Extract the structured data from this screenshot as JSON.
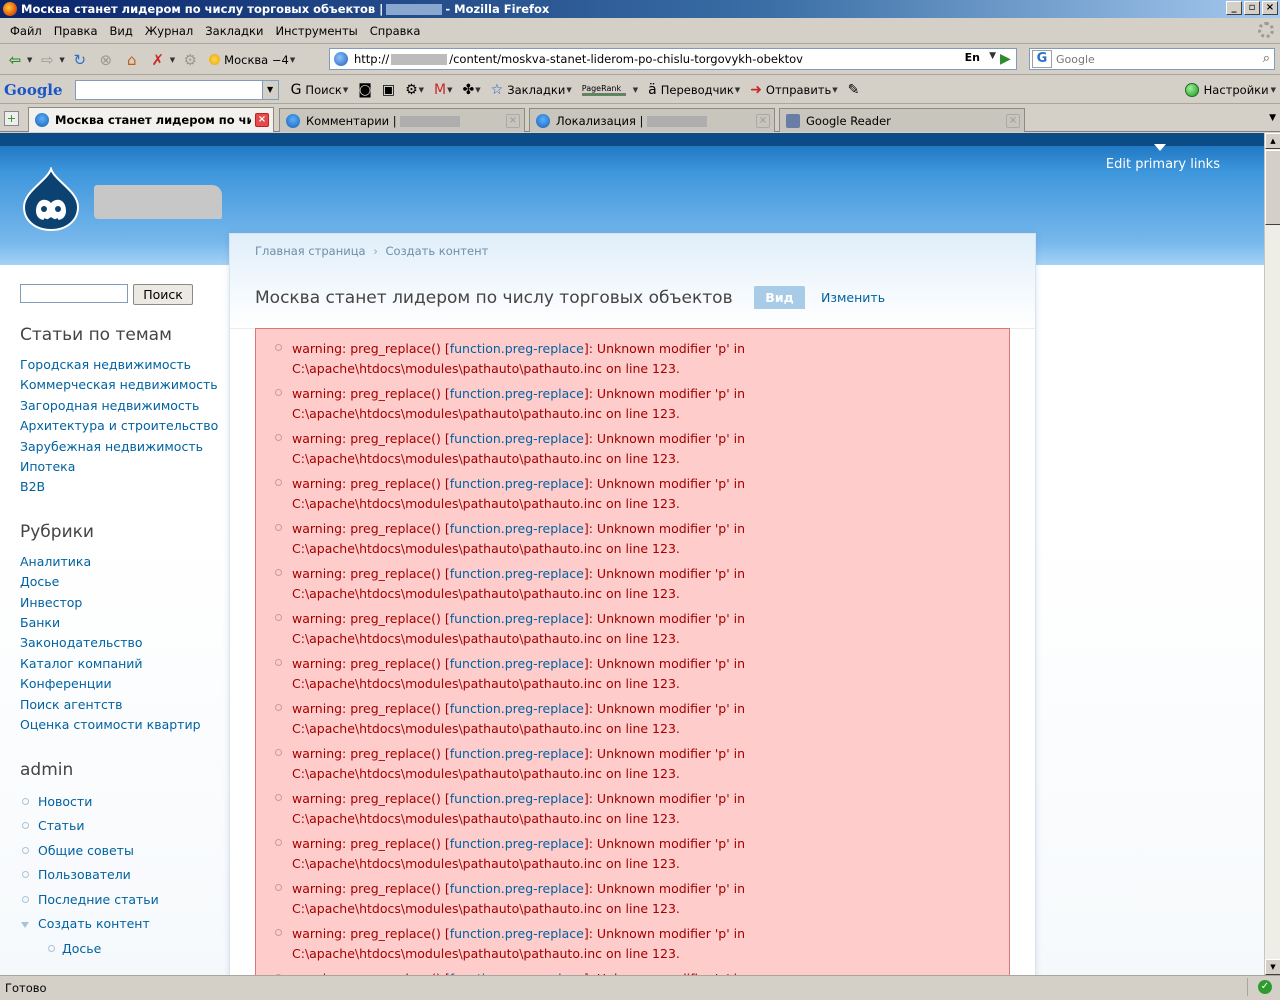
{
  "window": {
    "title_prefix": "Москва станет лидером по числу торговых объектов |",
    "title_suffix": "- Mozilla Firefox"
  },
  "menu": [
    "Файл",
    "Правка",
    "Вид",
    "Журнал",
    "Закладки",
    "Инструменты",
    "Справка"
  ],
  "navbar": {
    "weather": "Москва −4",
    "url_prefix": "http://",
    "url_suffix": "/content/moskva-stanet-liderom-po-chislu-torgovykh-obektov",
    "lang_indicator": "En",
    "search_placeholder": "Google"
  },
  "google_toolbar": {
    "logo": "Google",
    "search": "Поиск",
    "bookmarks": "Закладки",
    "pagerank": "PageRank",
    "translator": "Переводчик",
    "send": "Отправить",
    "settings": "Настройки"
  },
  "tabs": [
    {
      "label": "Москва станет лидером по чис...",
      "active": true
    },
    {
      "label": "Комментарии |",
      "active": false
    },
    {
      "label": "Локализация | ",
      "active": false
    },
    {
      "label": "Google Reader",
      "active": false
    }
  ],
  "page": {
    "edit_primary_links": "Edit primary links",
    "search_button": "Поиск",
    "blocks": {
      "topics": {
        "title": "Статьи по темам",
        "items": [
          "Городская недвижимость",
          "Коммерческая недвижимость",
          "Загородная недвижимость",
          "Архитектура и строительство",
          "Зарубежная недвижимость",
          "Ипотека",
          "B2B"
        ]
      },
      "rubrics": {
        "title": "Рубрики",
        "items": [
          "Аналитика",
          "Досье",
          "Инвестор",
          "Банки",
          "Законодательство",
          "Каталог компаний",
          "Конференции",
          "Поиск агентств",
          "Оценка стоимости квартир"
        ]
      },
      "admin": {
        "title": "admin",
        "items": [
          "Новости",
          "Статьи",
          "Общие советы",
          "Пользователи",
          "Последние статьи",
          "Создать контент",
          "Досье"
        ]
      }
    },
    "breadcrumb": [
      "Главная страница",
      "Создать контент"
    ],
    "breadcrumb_sep": "›",
    "node_title": "Москва станет лидером по числу торговых объектов",
    "tab_view": "Вид",
    "tab_edit": "Изменить",
    "warning": {
      "before": "warning: preg_replace() [",
      "link": "function.preg-replace",
      "after": "]: Unknown modifier 'p' in",
      "line2": "C:\\apache\\htdocs\\modules\\pathauto\\pathauto.inc on line 123.",
      "count": 15
    }
  },
  "status": "Готово"
}
